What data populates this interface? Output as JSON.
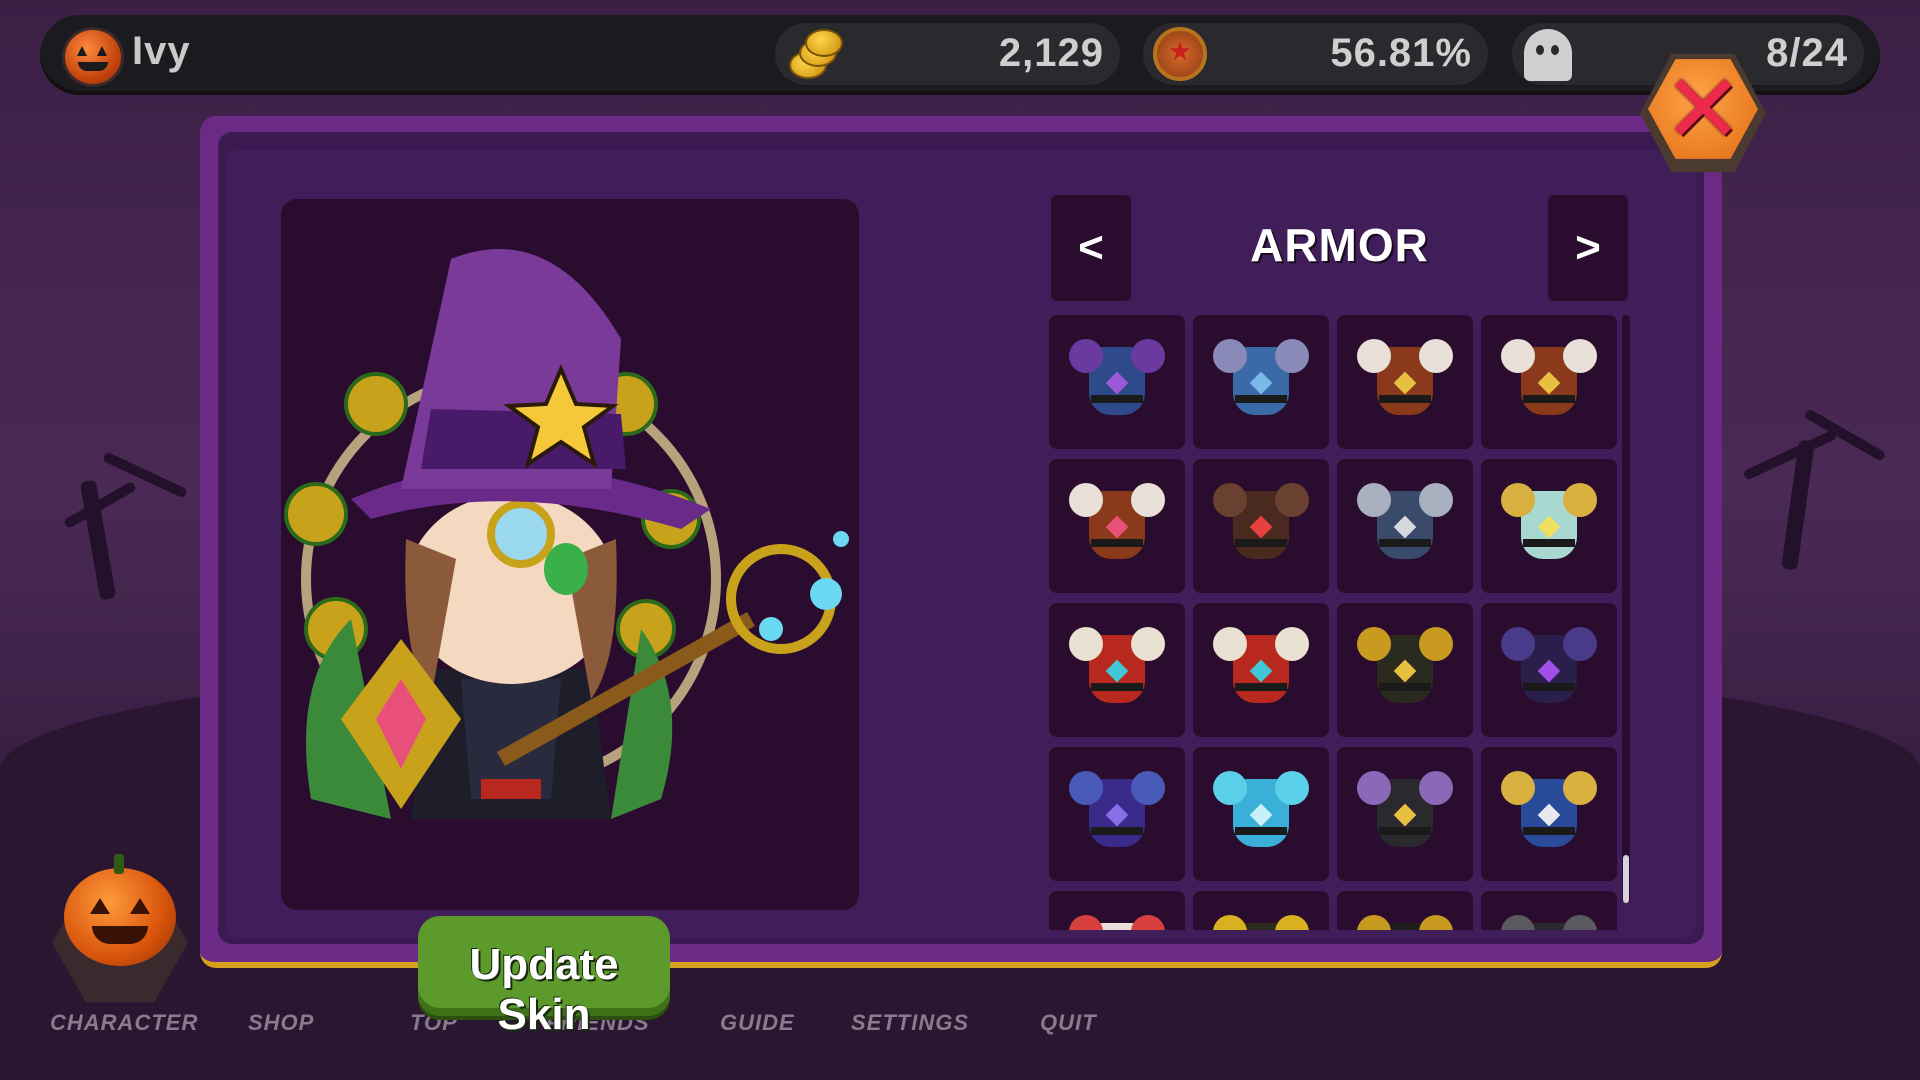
{
  "top_bar": {
    "player_name": "Ivy",
    "coins": "2,129",
    "rank_percent": "56.81%",
    "ghosts": "8/24",
    "icons": [
      "pumpkin-icon",
      "coins-icon",
      "medal-icon",
      "ghost-icon"
    ]
  },
  "close_button": {
    "icon": "close-icon"
  },
  "category": {
    "title": "ARMOR",
    "prev_label": "<",
    "next_label": ">"
  },
  "update_button": {
    "label": "Update Skin"
  },
  "bottom_nav": {
    "items": [
      {
        "label": "CHARACTER"
      },
      {
        "label": "SHOP"
      },
      {
        "label": "TOP"
      },
      {
        "label": "FRIENDS"
      },
      {
        "label": "GUIDE"
      },
      {
        "label": "SETTINGS"
      },
      {
        "label": "QUIT"
      }
    ]
  },
  "colors": {
    "panel": "#6a2a86",
    "panel_inner": "#3f1e59",
    "slot": "#2a0d2e",
    "accent_gold": "#d7a21b",
    "button_green": "#5d9a2c",
    "close_orange": "#f07e1c"
  },
  "armor_items": [
    {
      "name": "armor-icon",
      "main": "#2f4a8a",
      "shoulder": "#6a3aa0",
      "gem": "#9a5ad8"
    },
    {
      "name": "armor-icon",
      "main": "#3a6aa8",
      "shoulder": "#8a8ab8",
      "gem": "#7ab8e8"
    },
    {
      "name": "armor-icon",
      "main": "#8a3a1a",
      "shoulder": "#e8e0d8",
      "gem": "#e8c040"
    },
    {
      "name": "armor-icon",
      "main": "#8a3a1a",
      "shoulder": "#e8e0d8",
      "gem": "#e8c040"
    },
    {
      "name": "armor-icon",
      "main": "#8a3a1a",
      "shoulder": "#e8e0d8",
      "gem": "#e8507a"
    },
    {
      "name": "armor-icon",
      "main": "#4a2a1e",
      "shoulder": "#6a4030",
      "gem": "#e84040"
    },
    {
      "name": "armor-icon",
      "main": "#3a4a6a",
      "shoulder": "#a8b0c0",
      "gem": "#d8d8e0"
    },
    {
      "name": "armor-icon",
      "main": "#a8d8d0",
      "shoulder": "#d8b040",
      "gem": "#f0e060"
    },
    {
      "name": "armor-icon",
      "main": "#b8281e",
      "shoulder": "#e8e0d0",
      "gem": "#40c8d8"
    },
    {
      "name": "armor-icon",
      "main": "#b8281e",
      "shoulder": "#e8e0d0",
      "gem": "#40c8d8"
    },
    {
      "name": "armor-icon",
      "main": "#2a2a1e",
      "shoulder": "#c89a20",
      "gem": "#e8c040"
    },
    {
      "name": "armor-icon",
      "main": "#2a1e4a",
      "shoulder": "#4a3a8a",
      "gem": "#a050e8"
    },
    {
      "name": "armor-icon",
      "main": "#3a2a8a",
      "shoulder": "#4a5ab8",
      "gem": "#8a70e8"
    },
    {
      "name": "armor-icon",
      "main": "#3ab0d8",
      "shoulder": "#5ad0e8",
      "gem": "#c8f0f8"
    },
    {
      "name": "armor-icon",
      "main": "#2a2a2e",
      "shoulder": "#8a6ab8",
      "gem": "#e8c040"
    },
    {
      "name": "armor-icon",
      "main": "#2a4a9a",
      "shoulder": "#d8b040",
      "gem": "#e8e8f0"
    },
    {
      "name": "armor-icon",
      "main": "#e8e0d8",
      "shoulder": "#d84040",
      "gem": "#e8c040"
    },
    {
      "name": "armor-icon",
      "main": "#2a2a1e",
      "shoulder": "#d8b020",
      "gem": "#e84040"
    },
    {
      "name": "armor-icon",
      "main": "#1e1e1e",
      "shoulder": "#c89a20",
      "gem": "#e8c040"
    },
    {
      "name": "armor-icon",
      "main": "#2a2a2e",
      "shoulder": "#5a5a5e",
      "gem": "#e8c040"
    }
  ]
}
